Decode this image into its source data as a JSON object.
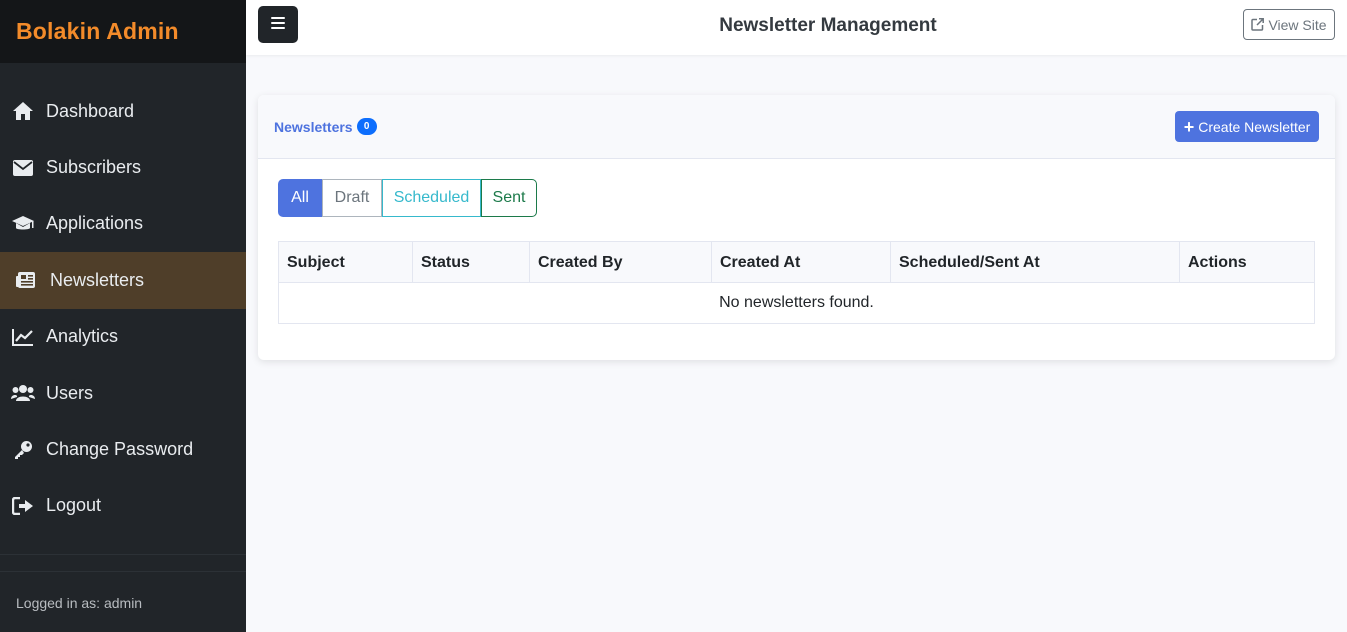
{
  "sidebar": {
    "brand": "Bolakin Admin",
    "items": [
      {
        "label": "Dashboard",
        "icon": "home-icon"
      },
      {
        "label": "Subscribers",
        "icon": "envelope-icon"
      },
      {
        "label": "Applications",
        "icon": "graduation-cap-icon"
      },
      {
        "label": "Newsletters",
        "icon": "newspaper-icon",
        "active": true
      },
      {
        "label": "Analytics",
        "icon": "line-chart-icon"
      },
      {
        "label": "Users",
        "icon": "users-icon"
      },
      {
        "label": "Change Password",
        "icon": "key-icon"
      },
      {
        "label": "Logout",
        "icon": "sign-out-icon"
      }
    ],
    "logged_in": "Logged in as: admin"
  },
  "topbar": {
    "title": "Newsletter Management",
    "view_site": "View Site"
  },
  "card": {
    "title": "Newsletters",
    "count": "0",
    "create_label": "Create Newsletter",
    "filters": [
      "All",
      "Draft",
      "Scheduled",
      "Sent"
    ],
    "active_filter": "All",
    "columns": [
      "Subject",
      "Status",
      "Created By",
      "Created At",
      "Scheduled/Sent At",
      "Actions"
    ],
    "empty_text": "No newsletters found."
  },
  "colors": {
    "brand": "#f38b2a",
    "primary": "#4e73df",
    "sidebar_bg": "#212529",
    "active_nav": "#4f3e29"
  }
}
